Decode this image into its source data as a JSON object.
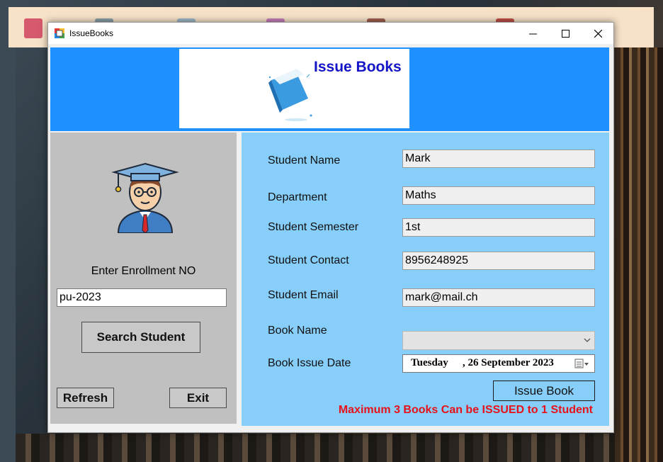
{
  "window": {
    "title": "IssueBooks",
    "minimize_icon": "minimize-icon",
    "maximize_icon": "maximize-icon",
    "close_icon": "close-icon"
  },
  "header": {
    "banner_title": "Issue Books",
    "banner_icon": "book-icon",
    "background_color": "#1e90ff"
  },
  "left_panel": {
    "avatar_icon": "student-graduate-icon",
    "enroll_label": "Enter Enrollment NO",
    "enroll_value": "pu-2023",
    "search_button": "Search Student",
    "refresh_button": "Refresh",
    "exit_button": "Exit"
  },
  "form": {
    "student_name_label": "Student Name",
    "student_name_value": "Mark",
    "department_label": "Department",
    "department_value": "Maths",
    "semester_label": "Student Semester",
    "semester_value": "1st",
    "contact_label": "Student Contact",
    "contact_value": "8956248925",
    "email_label": "Student Email",
    "email_value": "mark@mail.ch",
    "book_name_label": "Book Name",
    "book_name_value": "",
    "issue_date_label": "Book Issue Date",
    "issue_date_day": "Tuesday",
    "issue_date_rest": ", 26 September 2023",
    "issue_button": "Issue Book",
    "warning": "Maximum 3 Books Can be ISSUED to 1 Student"
  },
  "colors": {
    "right_panel": "#87cefa",
    "left_panel": "#c0c0c0",
    "warning": "#e8111a",
    "banner_title": "#1515c8"
  }
}
